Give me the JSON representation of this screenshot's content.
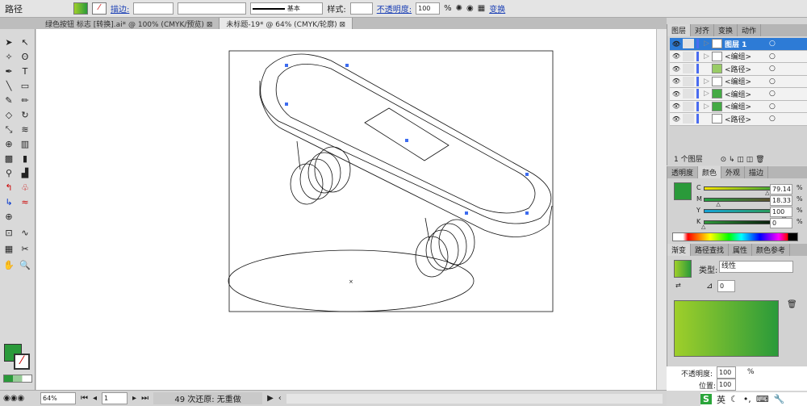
{
  "control_bar": {
    "selection_type": "路径",
    "stroke_label": "描边:",
    "line_style": "基本",
    "style_label": "样式:",
    "opacity_label": "不透明度:",
    "opacity_value": "100",
    "percent": "%",
    "transform_label": "变换"
  },
  "doc_tabs": [
    {
      "label": "绿色按钮 标志 [转换].ai* @ 100% (CMYK/预览)",
      "active": false
    },
    {
      "label": "未标题-19* @ 64% (CMYK/轮廓)",
      "active": true
    }
  ],
  "status_bar": {
    "zoom": "64%",
    "page": "1",
    "history": "49 次还原: 无重做"
  },
  "layers_panel": {
    "tabs": [
      "图层",
      "对齐",
      "变换",
      "动作"
    ],
    "rows": [
      {
        "name": "图层 1",
        "selected": true
      },
      {
        "name": "<编组>"
      },
      {
        "name": "<路径>"
      },
      {
        "name": "<编组>"
      },
      {
        "name": "<编组>"
      },
      {
        "name": "<编组>"
      },
      {
        "name": "<路径>"
      }
    ],
    "footer": "1 个图层"
  },
  "color_panel": {
    "tabs": [
      "透明度",
      "颜色",
      "外观",
      "描边"
    ],
    "channels": [
      {
        "label": "C",
        "value": "79.14",
        "fraction": 0.7914,
        "grad": "linear-gradient(90deg,#f5e400,#1f9a3d)"
      },
      {
        "label": "M",
        "value": "18.33",
        "fraction": 0.1833,
        "grad": "linear-gradient(90deg,#22a040,#6a3b2a)"
      },
      {
        "label": "Y",
        "value": "100",
        "fraction": 1,
        "grad": "linear-gradient(90deg,#15a3d8,#2f9a3c)"
      },
      {
        "label": "K",
        "value": "0",
        "fraction": 0,
        "grad": "linear-gradient(90deg,#2f9a3c,#000)"
      }
    ],
    "percent": "%",
    "fill_color": "#2a9a3a"
  },
  "gradient_panel": {
    "tabs": [
      "渐变",
      "路径查找",
      "属性",
      "颜色参考"
    ],
    "type_label": "类型:",
    "type_value": "线性",
    "angle": "0",
    "opacity_label": "不透明度:",
    "opacity_value": "100",
    "location_label": "位置:",
    "location_value": "100",
    "percent": "%",
    "start_color": "#9fcf2a",
    "end_color": "#2a9a3a"
  },
  "taskbar": {
    "ime": "英"
  }
}
